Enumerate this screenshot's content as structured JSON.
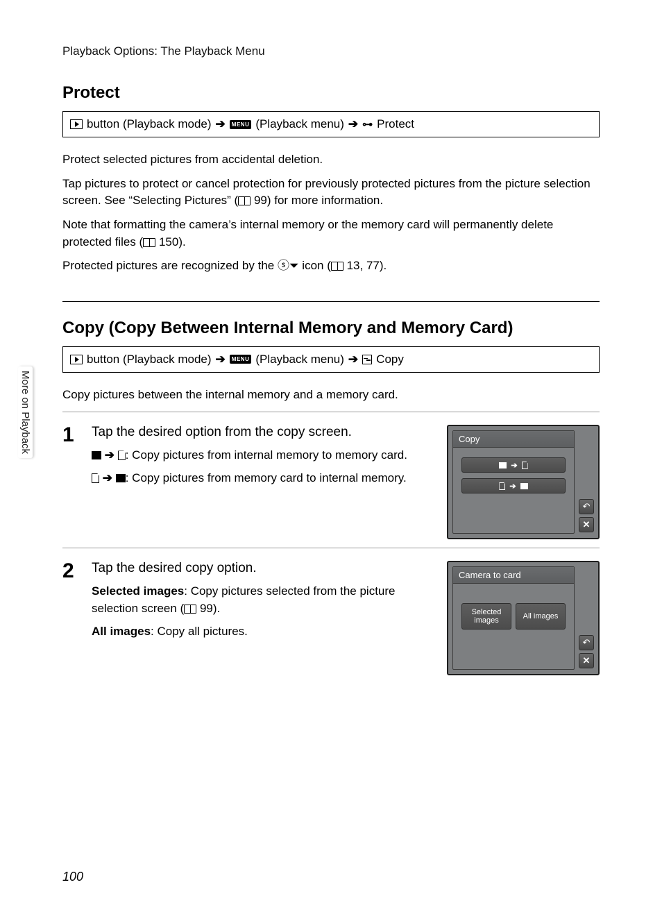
{
  "running_head": "Playback Options: The Playback Menu",
  "side_tab": "More on Playback",
  "page_number": "100",
  "protect": {
    "heading": "Protect",
    "nav": {
      "playback_mode": "button (Playback mode)",
      "playback_menu": "(Playback menu)",
      "item": "Protect"
    },
    "p1": "Protect selected pictures from accidental deletion.",
    "p2a": "Tap pictures to protect or cancel protection for previously protected pictures from the picture selection screen. See “Selecting Pictures” (",
    "p2_ref": "99",
    "p2b": ") for more information.",
    "p3a": "Note that formatting the camera’s internal memory or the memory card will permanently delete protected files (",
    "p3_ref": "150",
    "p3b": ").",
    "p4a": "Protected pictures are recognized by the ",
    "p4b": " icon (",
    "p4_ref": "13, 77",
    "p4c": ")."
  },
  "copy": {
    "heading": "Copy (Copy Between Internal Memory and Memory Card)",
    "nav": {
      "playback_mode": "button (Playback mode)",
      "playback_menu": "(Playback menu)",
      "item": "Copy"
    },
    "intro": "Copy pictures between the internal memory and a memory card."
  },
  "step1": {
    "num": "1",
    "title": "Tap the desired option from the copy screen.",
    "opt1": ": Copy pictures from internal memory to memory card.",
    "opt2": ": Copy pictures from memory card to internal memory.",
    "lcd_title": "Copy"
  },
  "step2": {
    "num": "2",
    "title": "Tap the desired copy option.",
    "opt1_label": "Selected images",
    "opt1_text": ": Copy pictures selected from the picture selection screen (",
    "opt1_ref": "99",
    "opt1_end": ").",
    "opt2_label": "All images",
    "opt2_text": ": Copy all pictures.",
    "lcd_title": "Camera to card",
    "tile1": "Selected images",
    "tile2": "All images"
  }
}
